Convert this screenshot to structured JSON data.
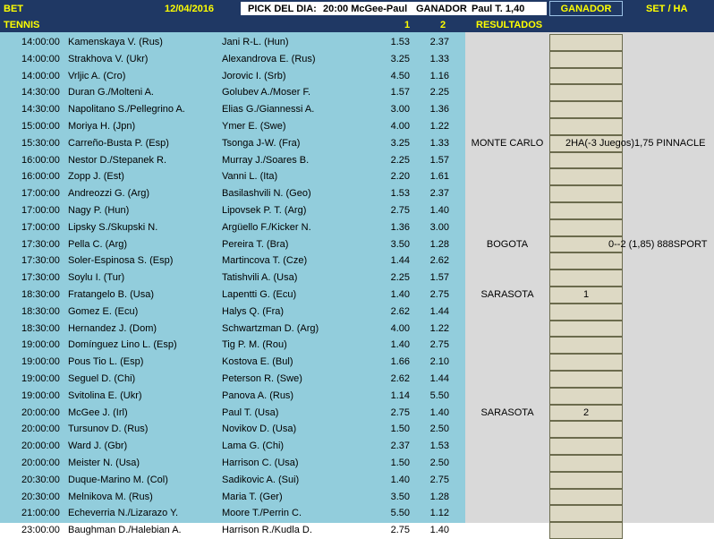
{
  "header": {
    "bet": "BET",
    "date": "12/04/2016",
    "pick_label": "PICK DEL DIA:",
    "pick_match": "20:00 McGee-Paul",
    "ganador_label": "GANADOR",
    "ganador_value": "Paul T. 1,40",
    "ganador_col": "GANADOR",
    "set_col": "SET / HA"
  },
  "subheader": {
    "sport": "TENNIS",
    "col1": "1",
    "col2": "2",
    "resultados": "RESULTADOS"
  },
  "colors": {
    "header_bg": "#1f3864",
    "header_text": "#ffff00",
    "grid_bg": "#92cddc",
    "result_bg": "#d9d9d9",
    "ganador_cell": "#ddd9c4"
  },
  "matches": [
    {
      "time": "14:00:00",
      "p1": "Kamenskaya V. (Rus)",
      "p2": "Jani R-L. (Hun)",
      "o1": "1.53",
      "o2": "2.37",
      "res": "",
      "gan": "",
      "set": ""
    },
    {
      "time": "14:00:00",
      "p1": "Strakhova V. (Ukr)",
      "p2": "Alexandrova E. (Rus)",
      "o1": "3.25",
      "o2": "1.33",
      "res": "",
      "gan": "",
      "set": ""
    },
    {
      "time": "14:00:00",
      "p1": "Vrljic A. (Cro)",
      "p2": "Jorovic I. (Srb)",
      "o1": "4.50",
      "o2": "1.16",
      "res": "",
      "gan": "",
      "set": ""
    },
    {
      "time": "14:30:00",
      "p1": "Duran G./Molteni A.",
      "p2": "Golubev A./Moser F.",
      "o1": "1.57",
      "o2": "2.25",
      "res": "",
      "gan": "",
      "set": ""
    },
    {
      "time": "14:30:00",
      "p1": "Napolitano S./Pellegrino A.",
      "p2": "Elias G./Giannessi A.",
      "o1": "3.00",
      "o2": "1.36",
      "res": "",
      "gan": "",
      "set": ""
    },
    {
      "time": "15:00:00",
      "p1": "Moriya H. (Jpn)",
      "p2": "Ymer E. (Swe)",
      "o1": "4.00",
      "o2": "1.22",
      "res": "",
      "gan": "",
      "set": ""
    },
    {
      "time": "15:30:00",
      "p1": "Carreño-Busta P. (Esp)",
      "p2": "Tsonga J-W. (Fra)",
      "o1": "3.25",
      "o2": "1.33",
      "res": "MONTE CARLO",
      "gan": "",
      "set": "2HA(-3 Juegos)1,75 PINNACLE"
    },
    {
      "time": "16:00:00",
      "p1": "Nestor D./Stepanek R.",
      "p2": "Murray J./Soares B.",
      "o1": "2.25",
      "o2": "1.57",
      "res": "",
      "gan": "",
      "set": ""
    },
    {
      "time": "16:00:00",
      "p1": "Zopp J. (Est)",
      "p2": "Vanni L. (Ita)",
      "o1": "2.20",
      "o2": "1.61",
      "res": "",
      "gan": "",
      "set": ""
    },
    {
      "time": "17:00:00",
      "p1": "Andreozzi G. (Arg)",
      "p2": "Basilashvili N. (Geo)",
      "o1": "1.53",
      "o2": "2.37",
      "res": "",
      "gan": "",
      "set": ""
    },
    {
      "time": "17:00:00",
      "p1": "Nagy P. (Hun)",
      "p2": "Lipovsek P. T. (Arg)",
      "o1": "2.75",
      "o2": "1.40",
      "res": "",
      "gan": "",
      "set": ""
    },
    {
      "time": "17:00:00",
      "p1": "Lipsky S./Skupski N.",
      "p2": "Argüello F./Kicker N.",
      "o1": "1.36",
      "o2": "3.00",
      "res": "",
      "gan": "",
      "set": ""
    },
    {
      "time": "17:30:00",
      "p1": "Pella C. (Arg)",
      "p2": "Pereira T. (Bra)",
      "o1": "3.50",
      "o2": "1.28",
      "res": "BOGOTA",
      "gan": "",
      "set": "0--2 (1,85) 888SPORT"
    },
    {
      "time": "17:30:00",
      "p1": "Soler-Espinosa S. (Esp)",
      "p2": "Martincova T. (Cze)",
      "o1": "1.44",
      "o2": "2.62",
      "res": "",
      "gan": "",
      "set": ""
    },
    {
      "time": "17:30:00",
      "p1": "Soylu I. (Tur)",
      "p2": "Tatishvili A. (Usa)",
      "o1": "2.25",
      "o2": "1.57",
      "res": "",
      "gan": "",
      "set": ""
    },
    {
      "time": "18:30:00",
      "p1": "Fratangelo B. (Usa)",
      "p2": "Lapentti G. (Ecu)",
      "o1": "1.40",
      "o2": "2.75",
      "res": "SARASOTA",
      "gan": "1",
      "set": ""
    },
    {
      "time": "18:30:00",
      "p1": "Gomez E. (Ecu)",
      "p2": "Halys Q. (Fra)",
      "o1": "2.62",
      "o2": "1.44",
      "res": "",
      "gan": "",
      "set": ""
    },
    {
      "time": "18:30:00",
      "p1": "Hernandez J. (Dom)",
      "p2": "Schwartzman D. (Arg)",
      "o1": "4.00",
      "o2": "1.22",
      "res": "",
      "gan": "",
      "set": ""
    },
    {
      "time": "19:00:00",
      "p1": "Domínguez Lino L. (Esp)",
      "p2": "Tig P. M. (Rou)",
      "o1": "1.40",
      "o2": "2.75",
      "res": "",
      "gan": "",
      "set": ""
    },
    {
      "time": "19:00:00",
      "p1": "Pous Tio L. (Esp)",
      "p2": "Kostova E. (Bul)",
      "o1": "1.66",
      "o2": "2.10",
      "res": "",
      "gan": "",
      "set": ""
    },
    {
      "time": "19:00:00",
      "p1": "Seguel D. (Chi)",
      "p2": "Peterson R. (Swe)",
      "o1": "2.62",
      "o2": "1.44",
      "res": "",
      "gan": "",
      "set": ""
    },
    {
      "time": "19:00:00",
      "p1": "Svitolina E. (Ukr)",
      "p2": "Panova A. (Rus)",
      "o1": "1.14",
      "o2": "5.50",
      "res": "",
      "gan": "",
      "set": ""
    },
    {
      "time": "20:00:00",
      "p1": "McGee J. (Irl)",
      "p2": "Paul T. (Usa)",
      "o1": "2.75",
      "o2": "1.40",
      "res": "SARASOTA",
      "gan": "2",
      "set": ""
    },
    {
      "time": "20:00:00",
      "p1": "Tursunov D. (Rus)",
      "p2": "Novikov D. (Usa)",
      "o1": "1.50",
      "o2": "2.50",
      "res": "",
      "gan": "",
      "set": ""
    },
    {
      "time": "20:00:00",
      "p1": "Ward J. (Gbr)",
      "p2": "Lama G. (Chi)",
      "o1": "2.37",
      "o2": "1.53",
      "res": "",
      "gan": "",
      "set": ""
    },
    {
      "time": "20:00:00",
      "p1": "Meister N. (Usa)",
      "p2": "Harrison C. (Usa)",
      "o1": "1.50",
      "o2": "2.50",
      "res": "",
      "gan": "",
      "set": ""
    },
    {
      "time": "20:30:00",
      "p1": "Duque-Marino M. (Col)",
      "p2": "Sadikovic A. (Sui)",
      "o1": "1.40",
      "o2": "2.75",
      "res": "",
      "gan": "",
      "set": ""
    },
    {
      "time": "20:30:00",
      "p1": "Melnikova M. (Rus)",
      "p2": "Maria T. (Ger)",
      "o1": "3.50",
      "o2": "1.28",
      "res": "",
      "gan": "",
      "set": ""
    },
    {
      "time": "21:00:00",
      "p1": "Echeverria N./Lizarazo Y.",
      "p2": "Moore T./Perrin C.",
      "o1": "5.50",
      "o2": "1.12",
      "res": "",
      "gan": "",
      "set": ""
    },
    {
      "time": "23:00:00",
      "p1": "Baughman D./Halebian A.",
      "p2": "Harrison R./Kudla D.",
      "o1": "2.75",
      "o2": "1.40",
      "res": "",
      "gan": "",
      "set": ""
    }
  ]
}
